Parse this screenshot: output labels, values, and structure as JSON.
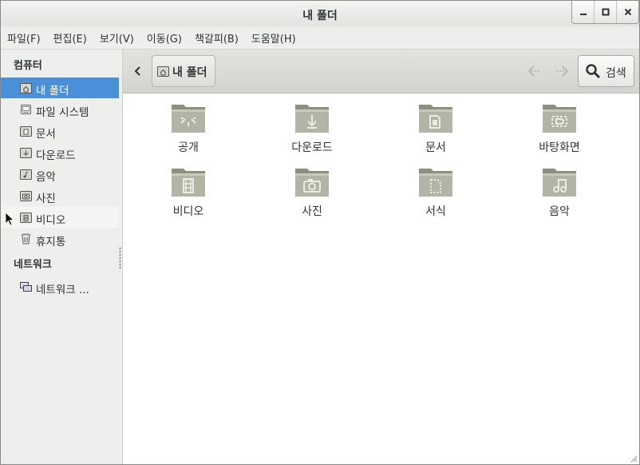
{
  "window": {
    "title": "내 폴더"
  },
  "menubar": {
    "items": [
      "파일(F)",
      "편집(E)",
      "보기(V)",
      "이동(G)",
      "책갈피(B)",
      "도움말(H)"
    ]
  },
  "sidebar": {
    "section_computer": "컴퓨터",
    "computer_items": [
      {
        "label": "내 폴더",
        "icon": "home-folder-icon",
        "selected": true
      },
      {
        "label": "파일 시스템",
        "icon": "drive-icon"
      },
      {
        "label": "문서",
        "icon": "documents-folder-icon"
      },
      {
        "label": "다운로드",
        "icon": "download-folder-icon"
      },
      {
        "label": "음악",
        "icon": "music-folder-icon"
      },
      {
        "label": "사진",
        "icon": "pictures-folder-icon"
      },
      {
        "label": "비디오",
        "icon": "video-folder-icon"
      },
      {
        "label": "휴지통",
        "icon": "trash-icon"
      }
    ],
    "section_network": "네트워크",
    "network_items": [
      {
        "label": "네트워크 ...",
        "icon": "network-icon"
      }
    ]
  },
  "toolbar": {
    "breadcrumb_label": "내 폴더",
    "search_label": "검색"
  },
  "files": [
    {
      "label": "공개",
      "icon": "public-folder-icon"
    },
    {
      "label": "다운로드",
      "icon": "download-folder-icon"
    },
    {
      "label": "문서",
      "icon": "documents-folder-icon"
    },
    {
      "label": "바탕화면",
      "icon": "desktop-folder-icon"
    },
    {
      "label": "비디오",
      "icon": "video-folder-icon"
    },
    {
      "label": "사진",
      "icon": "pictures-folder-icon"
    },
    {
      "label": "서식",
      "icon": "templates-folder-icon"
    },
    {
      "label": "음악",
      "icon": "music-folder-icon"
    }
  ],
  "colors": {
    "selection": "#4a90d9",
    "folder": "#a9a99a",
    "sidebar_bg": "#eeeeec"
  }
}
